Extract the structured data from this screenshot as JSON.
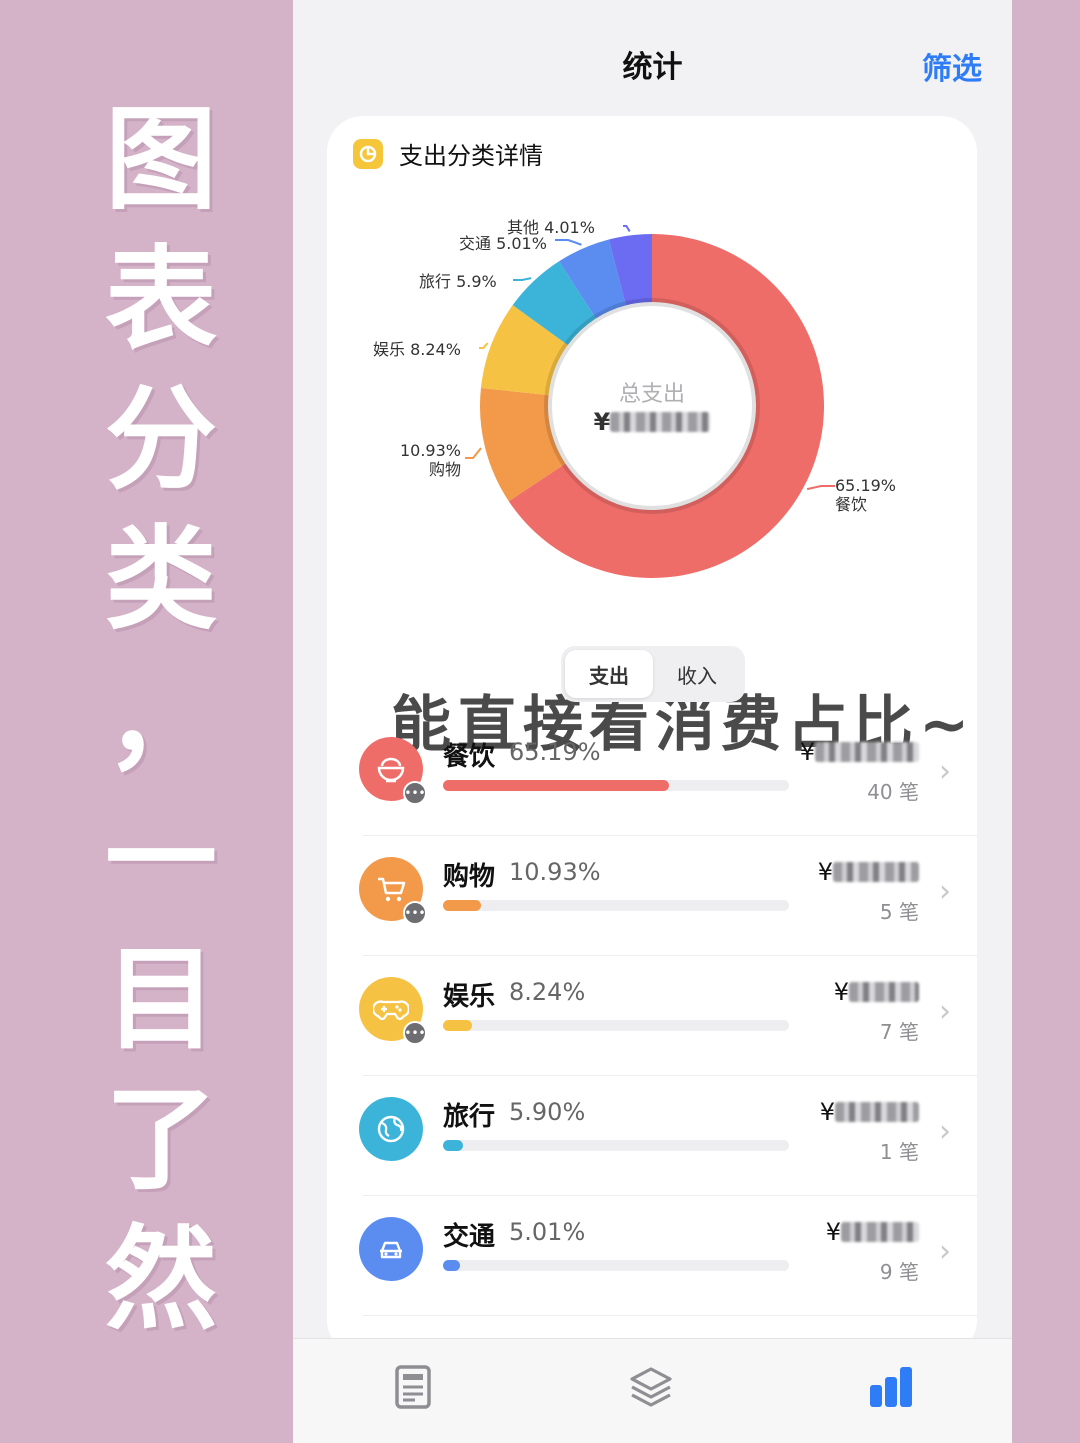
{
  "overlay": {
    "banner_chars": [
      "图",
      "表",
      "分",
      "类",
      "，",
      "一",
      "目",
      "了",
      "然"
    ],
    "caption": "能直接看消费占比~"
  },
  "nav": {
    "title": "统计",
    "filter": "筛选"
  },
  "card": {
    "title": "支出分类详情",
    "center_label": "总支出",
    "center_currency": "¥"
  },
  "chart_data": {
    "type": "pie",
    "categories": [
      "餐饮",
      "购物",
      "娱乐",
      "旅行",
      "交通",
      "其他"
    ],
    "values": [
      65.19,
      10.93,
      8.24,
      5.9,
      5.01,
      4.01
    ],
    "colors": [
      "#ef6d69",
      "#f2994a",
      "#f6c244",
      "#3cb4d9",
      "#5b8df0",
      "#6b6cf2"
    ],
    "labels": [
      {
        "pct": "65.19%",
        "name": "餐饮"
      },
      {
        "pct": "10.93%",
        "name": "购物"
      },
      {
        "text": "娱乐 8.24%"
      },
      {
        "text": "旅行 5.9%"
      },
      {
        "text": "交通 5.01%"
      },
      {
        "text": "其他 4.01%"
      }
    ]
  },
  "segment": {
    "options": [
      "支出",
      "收入"
    ],
    "selected": "支出"
  },
  "rows": [
    {
      "name": "餐饮",
      "pct_label": "65.19%",
      "fraction": 0.6519,
      "color": "#ef6d69",
      "icon": "rice-bowl-icon",
      "amount_prefix": "¥",
      "count": "40 笔"
    },
    {
      "name": "购物",
      "pct_label": "10.93%",
      "fraction": 0.1093,
      "color": "#f2994a",
      "icon": "shopping-cart-icon",
      "amount_prefix": "¥",
      "count": "5 笔"
    },
    {
      "name": "娱乐",
      "pct_label": "8.24%",
      "fraction": 0.0824,
      "color": "#f6c244",
      "icon": "gamepad-icon",
      "amount_prefix": "¥",
      "count": "7 笔"
    },
    {
      "name": "旅行",
      "pct_label": "5.90%",
      "fraction": 0.059,
      "color": "#3cb4d9",
      "icon": "globe-icon",
      "amount_prefix": "¥",
      "count": "1 笔"
    },
    {
      "name": "交通",
      "pct_label": "5.01%",
      "fraction": 0.0501,
      "color": "#5b8df0",
      "icon": "car-icon",
      "amount_prefix": "¥",
      "count": "9 笔"
    }
  ],
  "tabbar": {
    "items": [
      {
        "icon": "ledger-book-icon",
        "active": false
      },
      {
        "icon": "layers-icon",
        "active": false
      },
      {
        "icon": "bar-chart-icon",
        "active": true
      }
    ],
    "active_color": "#2f7df6",
    "inactive_color": "#8e8e93"
  }
}
